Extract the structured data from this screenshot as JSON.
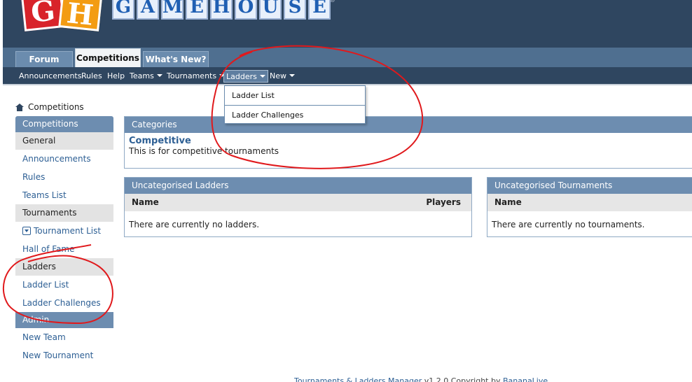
{
  "header": {
    "logo_letters": [
      "G",
      "H"
    ],
    "brand_letters": [
      "G",
      "A",
      "M",
      "E",
      "H",
      "O",
      "U",
      "S",
      "E"
    ],
    "reg_mark": "®"
  },
  "tabs": [
    "Forum",
    "Competitions",
    "What's New?"
  ],
  "active_tab": "Competitions",
  "subnav": [
    "Announcements",
    "Rules",
    "Help",
    "Teams",
    "Tournaments",
    "Ladders",
    "New"
  ],
  "dropdown": [
    "Ladder List",
    "Ladder Challenges"
  ],
  "breadcrumb": "Competitions",
  "sidebar": {
    "title": "Competitions",
    "general": {
      "label": "General",
      "links": [
        "Announcements",
        "Rules",
        "Teams List"
      ]
    },
    "tournaments": {
      "label": "Tournaments",
      "links": [
        "Tournament List",
        "Hall of Fame"
      ]
    },
    "ladders": {
      "label": "Ladders",
      "links": [
        "Ladder List",
        "Ladder Challenges"
      ]
    },
    "admin": {
      "label": "Admin",
      "links": [
        "New Team",
        "New Tournament"
      ]
    }
  },
  "categories": {
    "title": "Categories",
    "name": "Competitive",
    "description": "This is for competitive tournaments"
  },
  "ladders_panel": {
    "title": "Uncategorised Ladders",
    "col_name": "Name",
    "col_players": "Players",
    "empty": "There are currently no ladders."
  },
  "tournaments_panel": {
    "title": "Uncategorised Tournaments",
    "col_name": "Name",
    "empty": "There are currently no tournaments."
  },
  "footer": {
    "product": "Tournaments & Ladders Manager",
    "copyright": " v1.2.0 Copyright by ",
    "author": "BananaLive"
  },
  "colors": {
    "header_bg": "#2f4660",
    "panel_head": "#6d8db0",
    "link": "#2d5f94",
    "annotation": "#e0191c"
  }
}
